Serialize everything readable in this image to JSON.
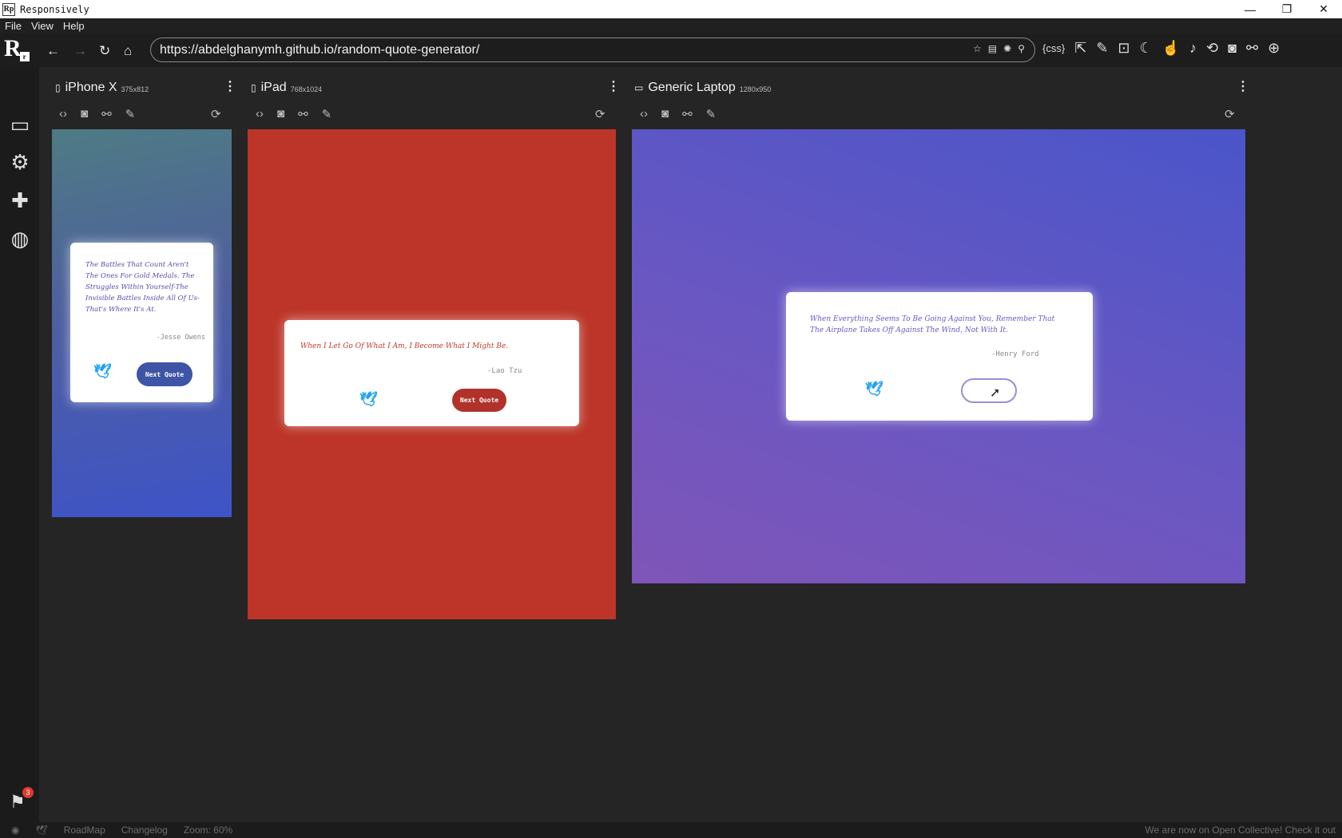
{
  "window": {
    "title": "Responsively",
    "app_icon": "Rp",
    "minimize": "—",
    "restore": "❐",
    "close": "✕"
  },
  "menu": [
    "File",
    "View",
    "Help"
  ],
  "toolbar": {
    "logo": "R",
    "logo_small": "r",
    "url": "https://abdelghanymh.github.io/random-quote-generator/",
    "css_label": "{css}"
  },
  "devices": [
    {
      "name": "iPhone X",
      "dims": "375x812",
      "quote": "The Battles That Count Aren't The Ones For Gold Medals. The Struggles Within Yourself-The Invisible Battles Inside All Of Us-That's Where It's At.",
      "author": "-Jesse Owens",
      "button": "Next Quote",
      "theme": "#5b4ba8"
    },
    {
      "name": "iPad",
      "dims": "768x1024",
      "quote": "When I Let Go Of What I Am, I Become What I Might Be.",
      "author": "-Lao Tzu",
      "button": "Next Quote",
      "theme": "#c0392b"
    },
    {
      "name": "Generic Laptop",
      "dims": "1280x950",
      "quote": "When Everything Seems To Be Going Against You, Remember That The Airplane Takes Off Against The Wind, Not With It.",
      "author": "-Henry Ford",
      "button": "",
      "theme": "#6a56c4"
    }
  ],
  "status": {
    "roadmap": "RoadMap",
    "changelog": "Changelog",
    "zoom": "Zoom: 60%",
    "notice": "We are now on Open Collective! Check it out",
    "gift_count": "3"
  }
}
